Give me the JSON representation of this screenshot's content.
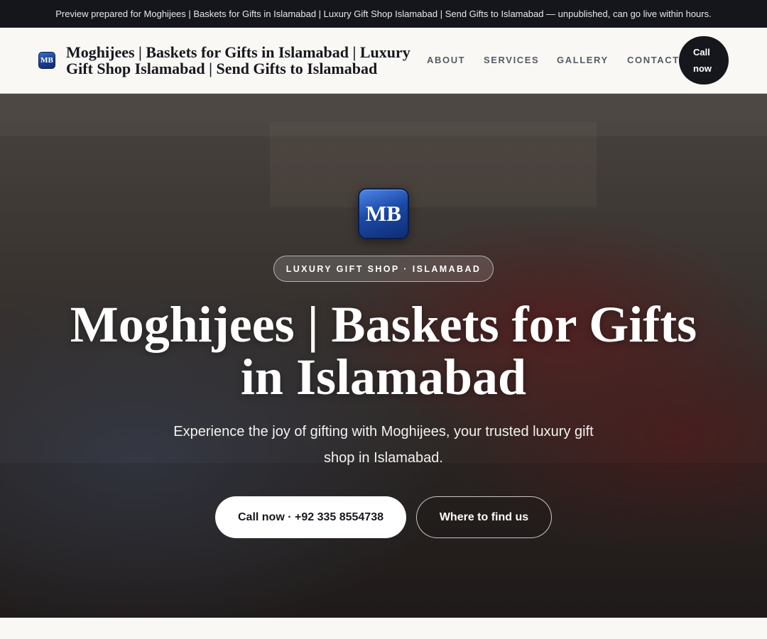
{
  "banner": {
    "text": "Preview prepared for Moghijees | Baskets for Gifts in Islamabad | Luxury Gift Shop Islamabad | Send Gifts to Islamabad — unpublished, can go live within hours."
  },
  "header": {
    "logo_text": "MB",
    "brand_name": "Moghijees | Baskets for Gifts in Islamabad | Luxury Gift Shop Islamabad | Send Gifts to Islamabad",
    "nav": [
      {
        "label": "ABOUT"
      },
      {
        "label": "SERVICES"
      },
      {
        "label": "GALLERY"
      },
      {
        "label": "CONTACT"
      }
    ],
    "call_label": "Call now"
  },
  "hero": {
    "logo_text": "MB",
    "badge": "LUXURY GIFT SHOP · ISLAMABAD",
    "title": "Moghijees | Baskets for Gifts in Islamabad",
    "subtitle": "Experience the joy of gifting with Moghijees, your trusted luxury gift shop in Islamabad.",
    "primary_cta": "Call now · +92 335 8554738",
    "secondary_cta": "Where to find us"
  },
  "colors": {
    "banner_bg": "#14161c",
    "accent_dark": "#15171d",
    "logo_blue": "#1c4aa8",
    "page_bg": "#faf8f4"
  }
}
